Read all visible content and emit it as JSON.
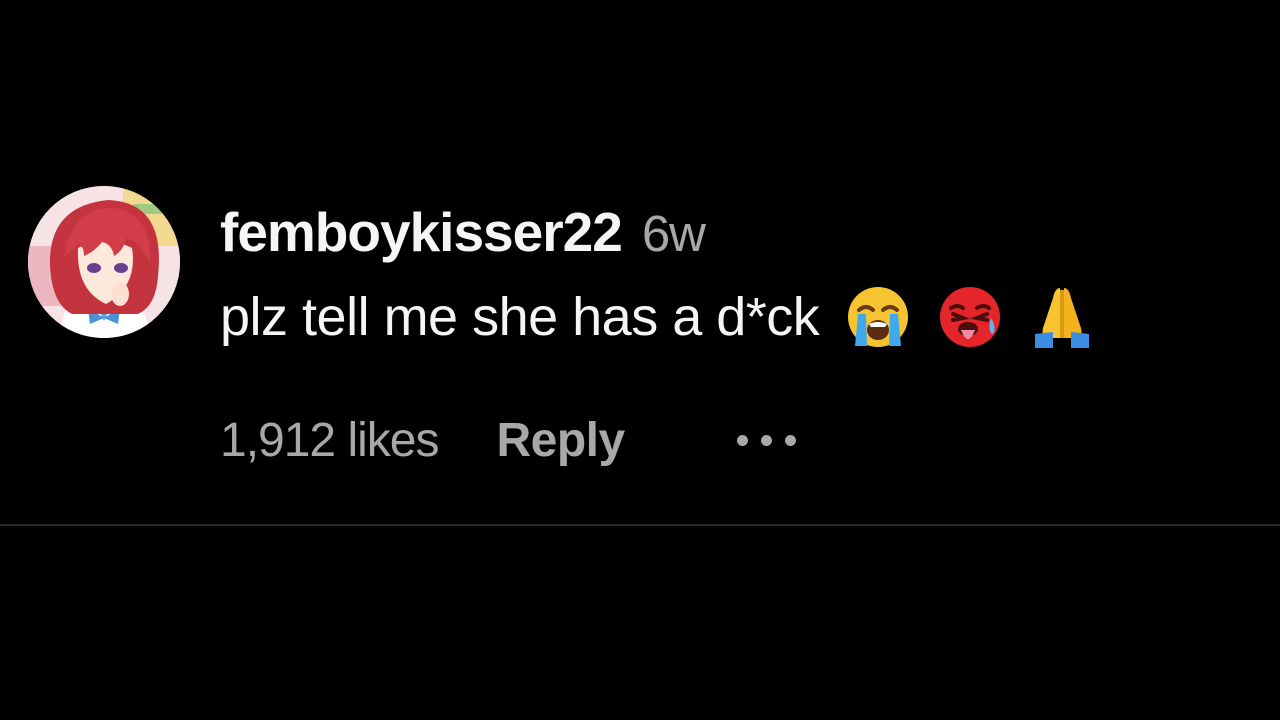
{
  "comment": {
    "username": "femboykisser22",
    "timestamp": "6w",
    "text": "plz tell me she has a d*ck",
    "emojis": [
      "loudly-crying-face-emoji",
      "hot-face-emoji",
      "folded-hands-emoji"
    ],
    "likes": "1,912 likes",
    "reply_label": "Reply",
    "more_icon": "more-options-icon",
    "avatar_icon": "avatar-anime-girl-red-hair"
  },
  "colors": {
    "background": "#000000",
    "primary_text": "#f5f5f5",
    "secondary_text": "#a8a8a8",
    "divider": "#2a2a2a"
  }
}
